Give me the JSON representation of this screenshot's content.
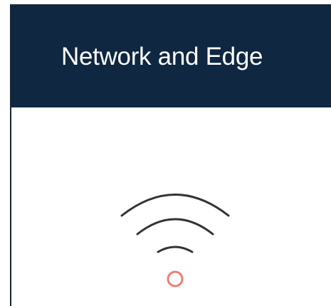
{
  "card": {
    "title": "Network and Edge",
    "icon": "wifi-signal-icon"
  },
  "colors": {
    "header_background": "#0f2740",
    "header_text": "#ffffff",
    "icon_stroke": "#333333",
    "icon_dot": "#f07c72"
  }
}
